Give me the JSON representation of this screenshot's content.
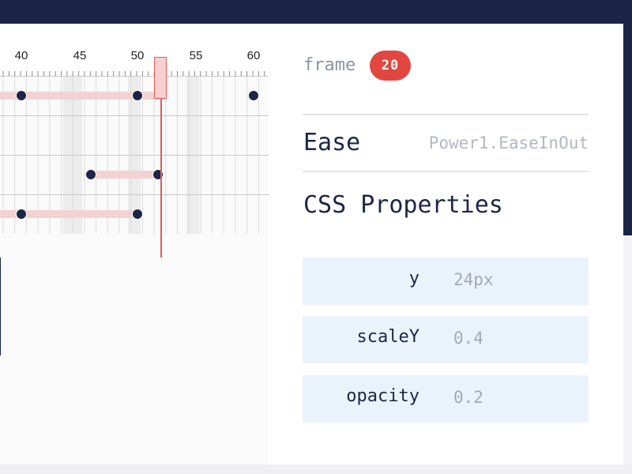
{
  "timeline": {
    "ruler_labels": [
      "40",
      "45",
      "50",
      "55",
      "60"
    ],
    "current_frame": 20,
    "tracks": [
      {
        "bars": [
          [
            0,
            52.5
          ]
        ],
        "keyframes": [
          40,
          50,
          60
        ]
      },
      {
        "bars": [],
        "keyframes": []
      },
      {
        "bars": [
          [
            46,
            51.8
          ]
        ],
        "keyframes": [
          46,
          51.8
        ]
      },
      {
        "bars": [
          [
            0,
            50
          ]
        ],
        "keyframes": [
          40,
          50
        ]
      }
    ]
  },
  "panel": {
    "frame_label": "frame",
    "frame_value": "20",
    "ease_label": "Ease",
    "ease_value": "Power1.EaseInOut",
    "css_title": "CSS Properties",
    "properties": [
      {
        "name": "y",
        "value": "24px"
      },
      {
        "name": "scaleY",
        "value": "0.4"
      },
      {
        "name": "opacity",
        "value": "0.2"
      }
    ]
  },
  "colors": {
    "navy": "#1d2547",
    "accent_red": "#e1473f",
    "bar_pink": "#f3d2d2",
    "row_blue": "#eaf3fc"
  }
}
